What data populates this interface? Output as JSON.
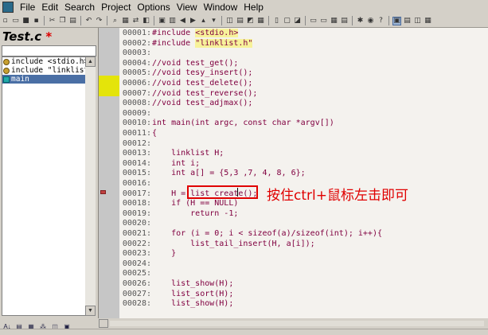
{
  "menubar": {
    "items": [
      "File",
      "Edit",
      "Search",
      "Project",
      "Options",
      "View",
      "Window",
      "Help"
    ]
  },
  "toolbar": {
    "icons": [
      "new-file-icon",
      "open-icon",
      "save-icon",
      "save-all-icon",
      "cut-icon",
      "copy-icon",
      "paste-icon",
      "undo-icon",
      "redo-icon",
      "find-icon",
      "find-files-icon",
      "replace-icon",
      "bookmark-icon",
      "jump-back-icon",
      "jump-forward-icon",
      "up-icon",
      "down-icon",
      "lookup-icon",
      "relation-icon",
      "context-icon",
      "window-tile-icon",
      "window-split-icon",
      "window-icon",
      "layout-icon",
      "symbol-toggle-icon",
      "info-icon",
      "browser-icon",
      "project-window-icon",
      "relation-window-icon",
      "context-window-icon"
    ]
  },
  "left_panel": {
    "file_title": "Test.c",
    "modified_marker": "*",
    "symbols": [
      {
        "label": "include <stdio.h>",
        "icon": "include-icon",
        "selected": false
      },
      {
        "label": "include \"linklist.",
        "icon": "include-icon",
        "selected": false
      },
      {
        "label": "main",
        "icon": "function-icon",
        "selected": true
      }
    ],
    "bottom_buttons": [
      "sort-az-icon",
      "list-view-icon",
      "category-icon",
      "tree-icon",
      "book-icon",
      "layout-icon"
    ]
  },
  "editor": {
    "lines": [
      {
        "num": "00001:",
        "text": "#include <stdio.h>",
        "kind": "include"
      },
      {
        "num": "00002:",
        "text": "#include \"linklist.h\"",
        "kind": "include"
      },
      {
        "num": "00003:",
        "text": "",
        "kind": "blank"
      },
      {
        "num": "00004:",
        "text": "//void test_get();",
        "kind": "comment"
      },
      {
        "num": "00005:",
        "text": "//void tesy_insert();",
        "kind": "comment"
      },
      {
        "num": "00006:",
        "text": "//void test_delete();",
        "kind": "comment"
      },
      {
        "num": "00007:",
        "text": "//void test_reverse();",
        "kind": "comment"
      },
      {
        "num": "00008:",
        "text": "//void test_adjmax();",
        "kind": "comment"
      },
      {
        "num": "00009:",
        "text": "",
        "kind": "blank"
      },
      {
        "num": "00010:",
        "text": "int main(int argc, const char *argv[])",
        "kind": "code"
      },
      {
        "num": "00011:",
        "text": "{",
        "kind": "code"
      },
      {
        "num": "00012:",
        "text": "",
        "kind": "blank"
      },
      {
        "num": "00013:",
        "text": "    linklist H;",
        "kind": "code"
      },
      {
        "num": "00014:",
        "text": "    int i;",
        "kind": "code"
      },
      {
        "num": "00015:",
        "text": "    int a[] = {5,3 ,7, 4, 8, 6};",
        "kind": "code"
      },
      {
        "num": "00016:",
        "text": "",
        "kind": "blank"
      },
      {
        "num": "00017:",
        "text": "    H = list_create();",
        "kind": "code"
      },
      {
        "num": "00018:",
        "text": "    if (H == NULL)",
        "kind": "code"
      },
      {
        "num": "00019:",
        "text": "        return -1;",
        "kind": "code"
      },
      {
        "num": "00020:",
        "text": "",
        "kind": "blank"
      },
      {
        "num": "00021:",
        "text": "    for (i = 0; i < sizeof(a)/sizeof(int); i++){",
        "kind": "code"
      },
      {
        "num": "00022:",
        "text": "        list_tail_insert(H, a[i]);",
        "kind": "code"
      },
      {
        "num": "00023:",
        "text": "    }",
        "kind": "code"
      },
      {
        "num": "00024:",
        "text": "",
        "kind": "blank"
      },
      {
        "num": "00025:",
        "text": "",
        "kind": "blank"
      },
      {
        "num": "00026:",
        "text": "    list_show(H);",
        "kind": "code"
      },
      {
        "num": "00027:",
        "text": "    list_sort(H);",
        "kind": "code"
      },
      {
        "num": "00028:",
        "text": "    list_show(H);",
        "kind": "code"
      }
    ],
    "annotation": "按住ctrl+鼠标左击即可"
  },
  "colors": {
    "code_text": "#800040",
    "annotation": "#e00000",
    "gutter_highlight": "#e4e40a",
    "selection": "#4a6fa5"
  }
}
